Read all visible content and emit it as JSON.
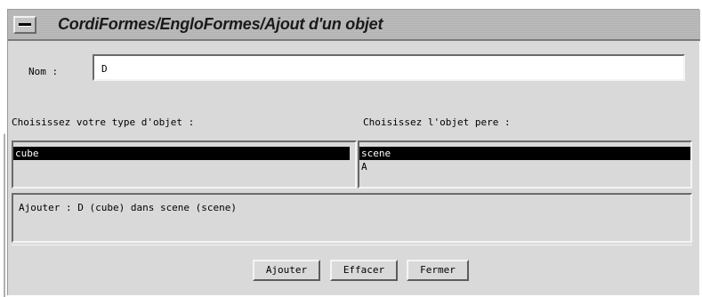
{
  "window": {
    "title": "CordiFormes/EngloFormes/Ajout d'un objet"
  },
  "nom": {
    "label": "Nom :",
    "value": "D"
  },
  "type_section": {
    "label": "Choisissez votre type d'objet :",
    "items": [
      {
        "label": "cube",
        "selected": true
      }
    ]
  },
  "pere_section": {
    "label": "Choisissez l'objet pere :",
    "items": [
      {
        "label": "scene",
        "selected": true
      },
      {
        "label": "A",
        "selected": false
      }
    ]
  },
  "status": {
    "text": "Ajouter : D (cube) dans scene (scene)"
  },
  "buttons": {
    "ajouter": "Ajouter",
    "effacer": "Effacer",
    "fermer": "Fermer"
  },
  "colors": {
    "window_bg": "#d9d9d9",
    "title_bar": "#b3b3b3",
    "selection_bg": "#000000",
    "selection_fg": "#ffffff"
  },
  "icons": {
    "window_menu": "window-menu-icon"
  }
}
